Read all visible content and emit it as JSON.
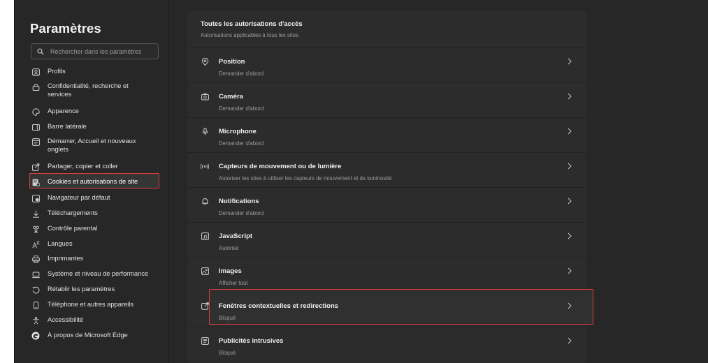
{
  "sidebar": {
    "title": "Paramètres",
    "search_placeholder": "Rechercher dans les paramètres",
    "items": [
      {
        "label": "Profils"
      },
      {
        "label": "Confidentialité, recherche et services"
      },
      {
        "label": "Apparence"
      },
      {
        "label": "Barre latérale"
      },
      {
        "label": "Démarrer, Accueil et nouveaux onglets"
      },
      {
        "label": "Partager, copier et coller"
      },
      {
        "label": "Cookies et autorisations de site"
      },
      {
        "label": "Navigateur par défaut"
      },
      {
        "label": "Téléchargements"
      },
      {
        "label": "Contrôle parental"
      },
      {
        "label": "Langues"
      },
      {
        "label": "Imprimantes"
      },
      {
        "label": "Système et niveau de performance"
      },
      {
        "label": "Rétablir les paramètres"
      },
      {
        "label": "Téléphone et autres appareils"
      },
      {
        "label": "Accessibilité"
      },
      {
        "label": "À propos de Microsoft Edge"
      }
    ],
    "active_item": "Cookies et autorisations de site"
  },
  "main": {
    "title": "Toutes les autorisations d'accès",
    "subtitle": "Autorisations applicables à tous les sites",
    "rows": [
      {
        "title": "Position",
        "subtitle": "Demander d'abord",
        "icon": "location-pin-icon"
      },
      {
        "title": "Caméra",
        "subtitle": "Demander d'abord",
        "icon": "camera-icon"
      },
      {
        "title": "Microphone",
        "subtitle": "Demander d'abord",
        "icon": "microphone-icon"
      },
      {
        "title": "Capteurs de mouvement ou de lumière",
        "subtitle": "Autoriser les sites à utiliser les capteurs de mouvement et de luminosité",
        "icon": "motion-sensor-icon"
      },
      {
        "title": "Notifications",
        "subtitle": "Demander d'abord",
        "icon": "bell-icon"
      },
      {
        "title": "JavaScript",
        "subtitle": "Autorisé",
        "icon": "javascript-icon"
      },
      {
        "title": "Images",
        "subtitle": "Afficher tout",
        "icon": "image-icon"
      },
      {
        "title": "Fenêtres contextuelles et redirections",
        "subtitle": "Bloqué",
        "icon": "popup-icon"
      },
      {
        "title": "Publicités intrusives",
        "subtitle": "Bloqué",
        "icon": "ad-icon"
      }
    ],
    "highlighted_row": "Fenêtres contextuelles et redirections"
  },
  "colors": {
    "background": "#272727",
    "panel": "#2c2c2c",
    "highlight_border": "#e03c3c",
    "text_primary": "#f0f0f0",
    "text_secondary": "#9c9c9c"
  }
}
